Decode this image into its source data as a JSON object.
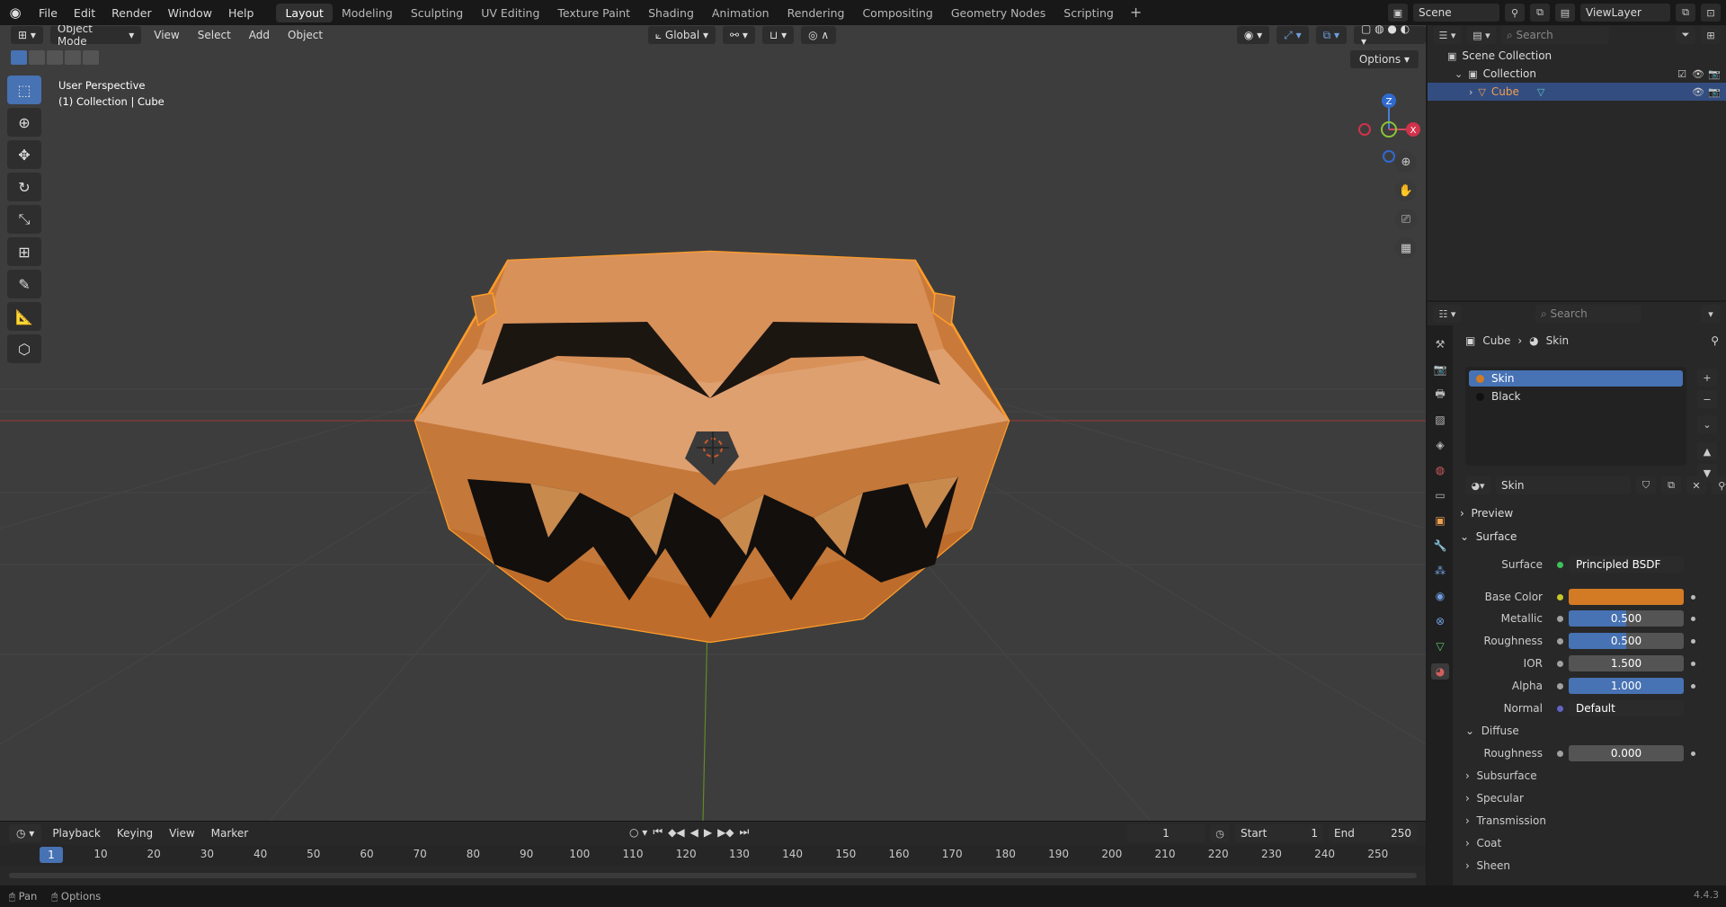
{
  "topbar": {
    "menus": [
      "File",
      "Edit",
      "Render",
      "Window",
      "Help"
    ],
    "workspaces": [
      "Layout",
      "Modeling",
      "Sculpting",
      "UV Editing",
      "Texture Paint",
      "Shading",
      "Animation",
      "Rendering",
      "Compositing",
      "Geometry Nodes",
      "Scripting"
    ],
    "active_workspace": "Layout",
    "scene": "Scene",
    "view_layer": "ViewLayer"
  },
  "viewport": {
    "mode": "Object Mode",
    "menus": [
      "View",
      "Select",
      "Add",
      "Object"
    ],
    "transform_orientation": "Global",
    "options_label": "Options",
    "info_line1": "User Perspective",
    "info_line2": "(1) Collection | Cube",
    "gizmo": {
      "z": "Z",
      "x": "X"
    }
  },
  "timeline": {
    "menus": [
      "Playback",
      "Keying",
      "View",
      "Marker"
    ],
    "current_frame": "1",
    "start_label": "Start",
    "start": "1",
    "end_label": "End",
    "end": "250",
    "ticks": [
      "10",
      "20",
      "30",
      "40",
      "50",
      "60",
      "70",
      "80",
      "90",
      "100",
      "110",
      "120",
      "130",
      "140",
      "150",
      "160",
      "170",
      "180",
      "190",
      "200",
      "210",
      "220",
      "230",
      "240",
      "250"
    ]
  },
  "statusbar": {
    "pan": "Pan",
    "options": "Options",
    "version": "4.4.3"
  },
  "outliner": {
    "search_placeholder": "Search",
    "scene_collection": "Scene Collection",
    "collection": "Collection",
    "object": "Cube"
  },
  "properties": {
    "search_placeholder": "Search",
    "breadcrumb_object": "Cube",
    "breadcrumb_material": "Skin",
    "slots": [
      "Skin",
      "Black"
    ],
    "material_name": "Skin",
    "preview": "Preview",
    "surface_panel": "Surface",
    "surface_label": "Surface",
    "surface_value": "Principled BSDF",
    "base_color_label": "Base Color",
    "base_color": "#d27a24",
    "metallic_label": "Metallic",
    "metallic": "0.500",
    "roughness_label": "Roughness",
    "roughness": "0.500",
    "ior_label": "IOR",
    "ior": "1.500",
    "alpha_label": "Alpha",
    "alpha": "1.000",
    "normal_label": "Normal",
    "normal": "Default",
    "diffuse": "Diffuse",
    "diffuse_roughness_label": "Roughness",
    "diffuse_roughness": "0.000",
    "subpanels": [
      "Subsurface",
      "Specular",
      "Transmission",
      "Coat",
      "Sheen"
    ]
  }
}
